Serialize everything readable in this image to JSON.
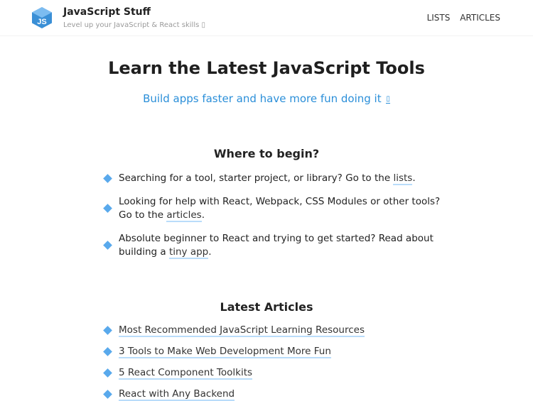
{
  "header": {
    "brand_title": "JavaScript Stuff",
    "brand_tagline": "Level up your JavaScript & React skills ▯",
    "nav": [
      "LISTS",
      "ARTICLES"
    ]
  },
  "logo": {
    "label": "JS",
    "color": "#3a8fd6"
  },
  "hero": {
    "title": "Learn the Latest JavaScript Tools",
    "subtitle": "Build apps faster and have more fun doing it",
    "subtitle_glyph": "▯"
  },
  "begin": {
    "title": "Where to begin?",
    "items": [
      {
        "before": "Searching for a tool, starter project, or library? Go to the ",
        "link": "lists",
        "after": "."
      },
      {
        "before": "Looking for help with React, Webpack, CSS Modules or other tools? Go to the ",
        "link": "articles",
        "after": "."
      },
      {
        "before": "Absolute beginner to React and trying to get started? Read about building a ",
        "link": "tiny app",
        "after": "."
      }
    ]
  },
  "latest": {
    "title": "Latest Articles",
    "items": [
      "Most Recommended JavaScript Learning Resources",
      "3 Tools to Make Web Development More Fun",
      "5 React Component Toolkits",
      "React with Any Backend"
    ]
  },
  "colors": {
    "accent": "#2b8fd9",
    "bullet": "#59a9ec",
    "underline": "#b9dcfa"
  }
}
